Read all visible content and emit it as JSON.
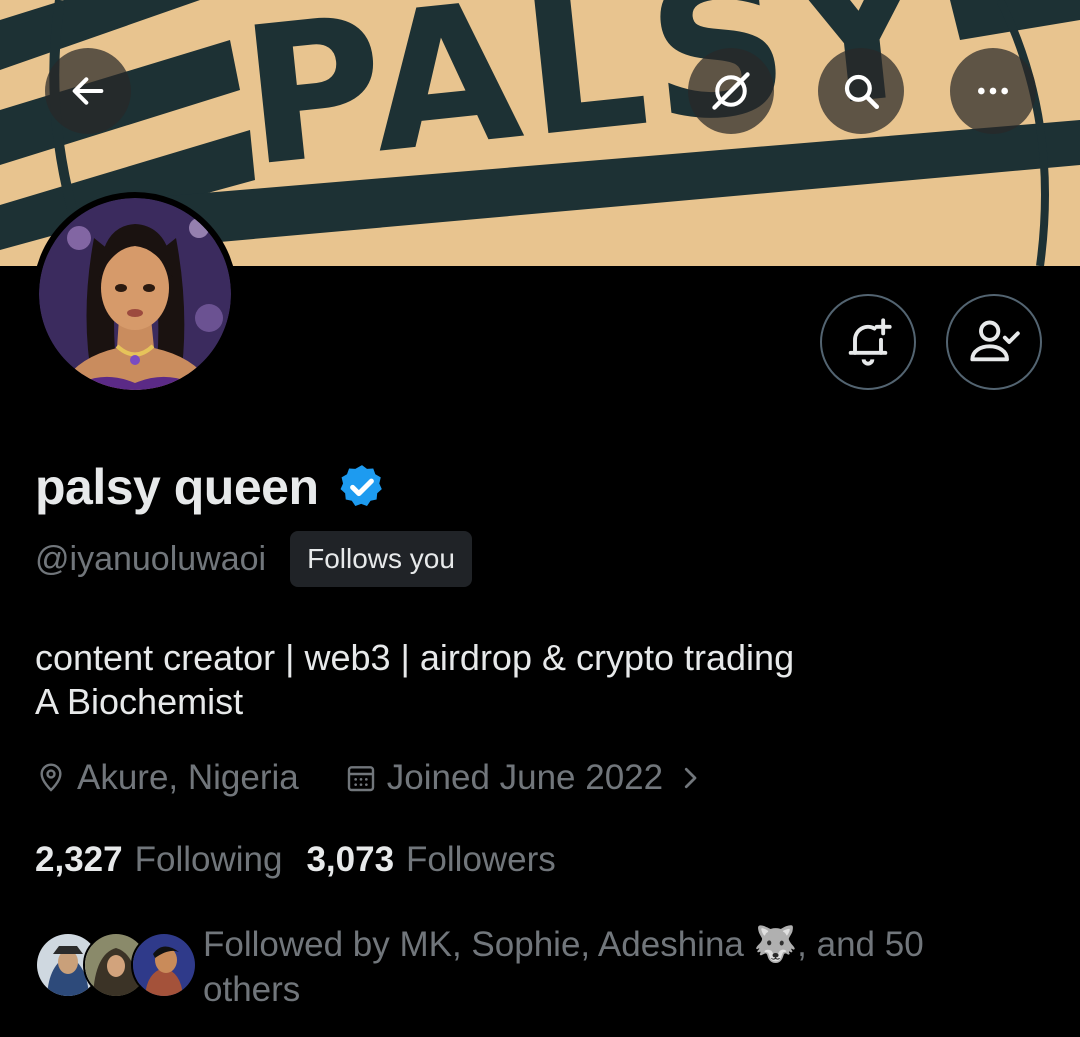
{
  "banner": {
    "text": "PALSY",
    "color_bg": "#e8c48f",
    "color_ink": "#1d3134"
  },
  "top_bar": {
    "back_icon": "arrow-left-icon",
    "grok_icon": "grok-icon",
    "search_icon": "search-icon",
    "more_icon": "more-icon"
  },
  "actions": {
    "notify_icon": "bell-plus-icon",
    "following_icon": "person-check-icon"
  },
  "profile": {
    "display_name": "palsy queen",
    "handle": "@iyanuoluwaoi",
    "follows_you": "Follows you",
    "verified_color": "#1d9bf0",
    "bio_line1": "content creator | web3 | airdrop & crypto trading",
    "bio_line2": "A Biochemist",
    "location": "Akure, Nigeria",
    "joined": "Joined June 2022",
    "following_count": "2,327",
    "following_label": "Following",
    "followers_count": "3,073",
    "followers_label": "Followers",
    "followed_by": "Followed by MK, Sophie, Adeshina 🐺, and 50 others"
  }
}
